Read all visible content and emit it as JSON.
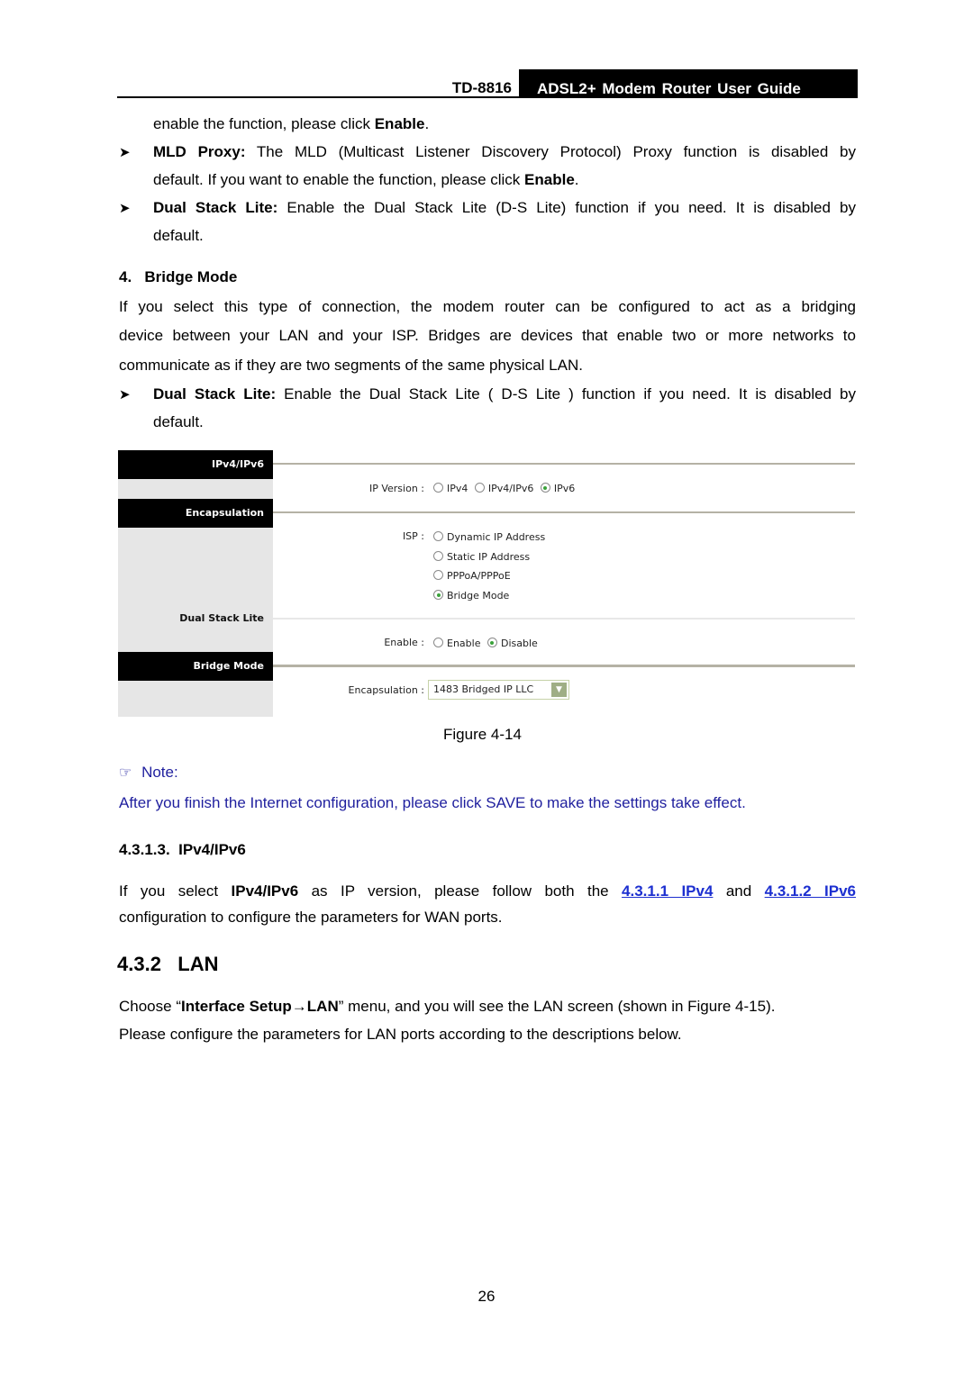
{
  "header": {
    "model": "TD-8816",
    "guide_title": "ADSL2+ Modem Router User Guide"
  },
  "intro": {
    "line1_prefix": "enable the function, please click ",
    "line1_bold": "Enable",
    "line1_suffix": ".",
    "bullets": [
      {
        "term": "MLD Proxy:",
        "line1": " The MLD (Multicast Listener Discovery Protocol) Proxy function is disabled by",
        "line2_prefix": "default. If you want to enable the function, please click ",
        "line2_bold": "Enable",
        "line2_suffix": "."
      },
      {
        "term": "Dual Stack Lite:",
        "line1": " Enable the Dual Stack Lite (D-S Lite) function if you need. It is disabled by",
        "line2": "default."
      }
    ]
  },
  "bridge_mode": {
    "heading": "4.   Bridge Mode",
    "para_lines": [
      "If you select this type of connection, the modem router can be configured to act as a bridging",
      "device between your LAN and your ISP. Bridges are devices that enable two or more networks to",
      "communicate as if they are two segments of the same physical LAN."
    ],
    "bullet": {
      "term": "Dual Stack Lite:",
      "line1": " Enable the Dual Stack Lite ( D-S Lite ) function if you need. It is disabled by",
      "line2": "default."
    }
  },
  "figure": {
    "sections": [
      "IPv4/IPv6",
      "Encapsulation",
      "Dual Stack Lite",
      "Bridge Mode"
    ],
    "ip_version": {
      "label": "IP Version :",
      "options": [
        {
          "label": "IPv4",
          "selected": false
        },
        {
          "label": "IPv4/IPv6",
          "selected": false
        },
        {
          "label": "IPv6",
          "selected": true
        }
      ]
    },
    "isp": {
      "label": "ISP :",
      "options": [
        {
          "label": "Dynamic IP Address",
          "selected": false
        },
        {
          "label": "Static IP Address",
          "selected": false
        },
        {
          "label": "PPPoA/PPPoE",
          "selected": false
        },
        {
          "label": "Bridge Mode",
          "selected": true
        }
      ]
    },
    "dslite_enable": {
      "label": "Enable :",
      "options": [
        {
          "label": "Enable",
          "selected": false
        },
        {
          "label": "Disable",
          "selected": true
        }
      ]
    },
    "encapsulation": {
      "label": "Encapsulation :",
      "value": "1483 Bridged IP LLC",
      "arrow": "chevron-down-icon"
    },
    "caption": "Figure 4-14"
  },
  "note": {
    "icon": "pointing-hand-icon",
    "title": "Note:",
    "text": "After you finish the Internet configuration, please click SAVE to make the settings take effect.",
    "color": "#1f1f9e"
  },
  "ipv4ipv6": {
    "heading": "4.3.1.3.  IPv4/IPv6",
    "p1_a": "If you select ",
    "p1_bold": "IPv4/IPv6",
    "p1_b": " as IP version, please follow both the ",
    "link1": "4.3.1.1 IPv4",
    "p1_c": " and ",
    "link2": "4.3.1.2 IPv6",
    "p2": "configuration to configure the parameters for WAN ports.",
    "link_color": "#1c2fd0"
  },
  "lan": {
    "heading": "4.3.2   LAN",
    "p1_a": "Choose “",
    "p1_bold": "Interface Setup→LAN",
    "p1_b": "” menu, and you will see the LAN screen (shown in Figure 4-15).",
    "p2": "Please configure the parameters for LAN ports according to the descriptions below."
  },
  "page_number": "26"
}
